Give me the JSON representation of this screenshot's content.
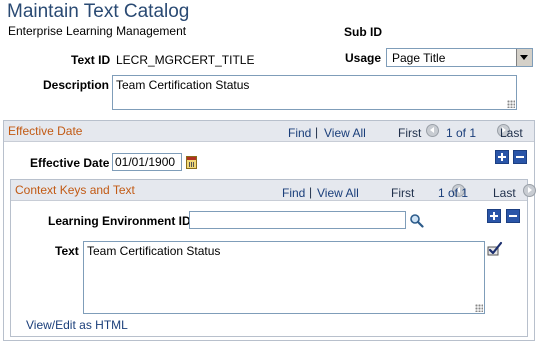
{
  "page": {
    "title": "Maintain Text Catalog",
    "subtitle": "Enterprise Learning Management"
  },
  "fields": {
    "sub_id_label": "Sub ID",
    "text_id_label": "Text ID",
    "text_id_value": "LECR_MGRCERT_TITLE",
    "usage_label": "Usage",
    "usage_value": "Page Title",
    "description_label": "Description",
    "description_value": "Team Certification Status"
  },
  "effective_date_section": {
    "header": "Effective Date",
    "find": "Find",
    "separator": "|",
    "view_all": "View All",
    "first": "First",
    "position": "1 of 1",
    "last": "Last",
    "effective_date_label": "Effective Date",
    "effective_date_value": "01/01/1900"
  },
  "context_section": {
    "header": "Context Keys and Text",
    "find": "Find",
    "separator": "|",
    "view_all": "View All",
    "first": "First",
    "position": "1 of 1",
    "last": "Last",
    "learning_env_label": "Learning Environment ID",
    "learning_env_value": "",
    "text_label": "Text",
    "text_value": "Team Certification Status",
    "view_edit_html": "View/Edit as HTML"
  },
  "icons": {
    "lookup": "magnifier-icon",
    "spellcheck": "spellcheck-icon",
    "calendar": "calendar-icon"
  },
  "colors": {
    "title": "#2a4a73",
    "section_header_text": "#c25a14",
    "section_header_bg": "#e5e8ee",
    "link": "#1a3e7a",
    "add_button": "#2a55a8"
  }
}
